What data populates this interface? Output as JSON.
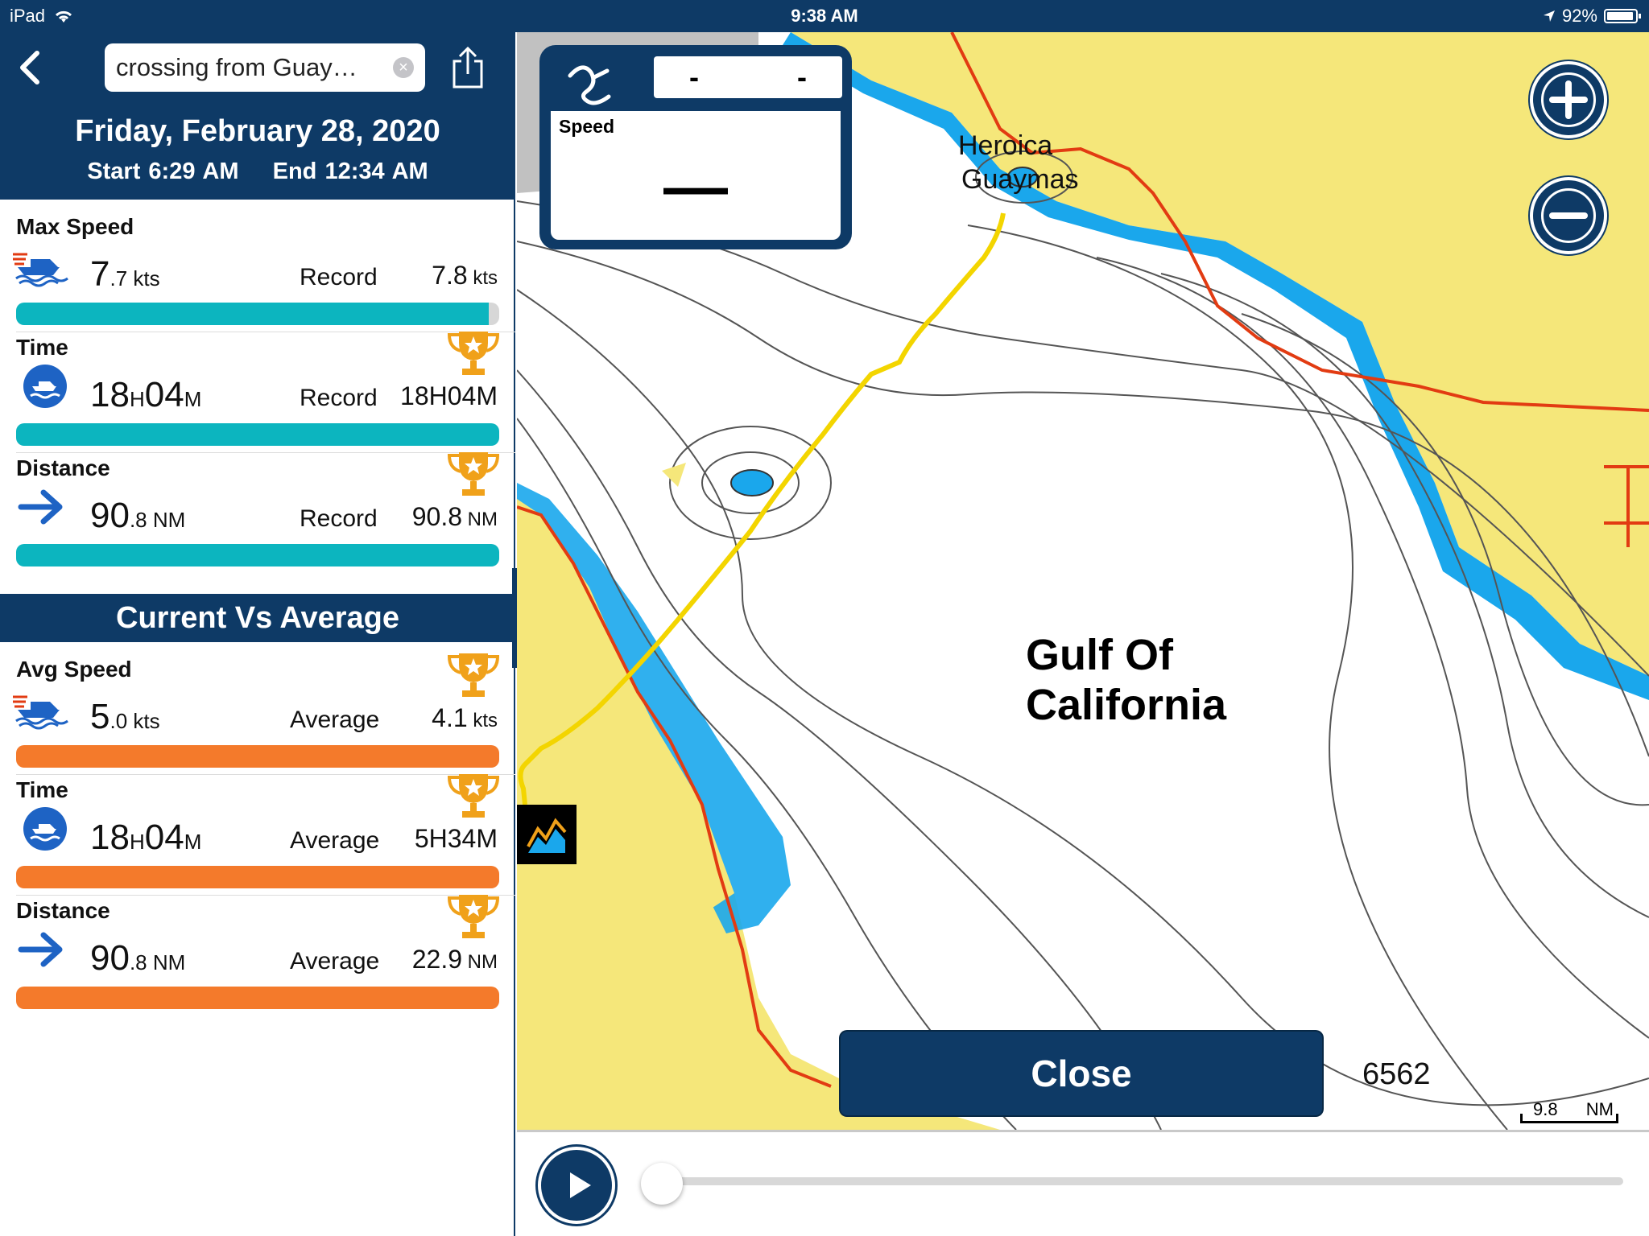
{
  "status_bar": {
    "device": "iPad",
    "time": "9:38 AM",
    "battery": "92%"
  },
  "header": {
    "search_value": "crossing from Guay…",
    "clear": "×"
  },
  "trip": {
    "date": "Friday, February 28, 2020",
    "start": "Start 6:29 AM",
    "end": "End 12:34 AM"
  },
  "records": {
    "max_speed": {
      "title": "Max Speed",
      "value_big": "7",
      "value_dec": ".7 kts",
      "record_label": "Record",
      "record_big": "7.8",
      "record_unit": " kts",
      "progress": 0.987
    },
    "time": {
      "title": "Time",
      "value_big": "18",
      "value_h": "H",
      "value_m": "04",
      "value_mu": "M",
      "record_label": "Record",
      "record_value": "18H04M",
      "progress": 1.0
    },
    "distance": {
      "title": "Distance",
      "value_big": "90",
      "value_dec": ".8 NM",
      "record_label": "Record",
      "record_big": "90.8",
      "record_unit": " NM",
      "progress": 1.0
    }
  },
  "comparison": {
    "section_title": "Current Vs Average",
    "avg_speed": {
      "title": "Avg Speed",
      "value_big": "5",
      "value_dec": ".0 kts",
      "label": "Average",
      "avg_big": "4.1",
      "avg_unit": " kts"
    },
    "time": {
      "title": "Time",
      "value_big": "18",
      "value_h": "H",
      "value_m": "04",
      "value_mu": "M",
      "label": "Average",
      "avg_value": "5H34M"
    },
    "distance": {
      "title": "Distance",
      "value_big": "90",
      "value_dec": ".8 NM",
      "label": "Average",
      "avg_big": "22.9",
      "avg_unit": " NM"
    }
  },
  "map": {
    "gulf_label_1": "Gulf Of",
    "gulf_label_2": "California",
    "city_1": "Heroica",
    "city_2": "Guaymas",
    "depth_label": "6562",
    "scale_value": "9.8",
    "scale_unit": "NM",
    "close_label": "Close",
    "speed_widget": {
      "label": "Speed",
      "value": "—",
      "top_left": "-",
      "top_right": "-"
    },
    "colors": {
      "land": "#f5e77a",
      "shallow": "#1aa7ec",
      "route": "#f3d500",
      "border": "#e23b12",
      "brand": "#0e3a66"
    }
  },
  "icons": {
    "back": "chevron-left-icon",
    "share": "share-icon",
    "boat": "boat-icon",
    "arrow": "arrow-right-icon",
    "trophy": "trophy-icon",
    "zoom_in": "plus-icon",
    "zoom_out": "minus-icon",
    "play": "play-icon",
    "chart": "chart-icon"
  }
}
